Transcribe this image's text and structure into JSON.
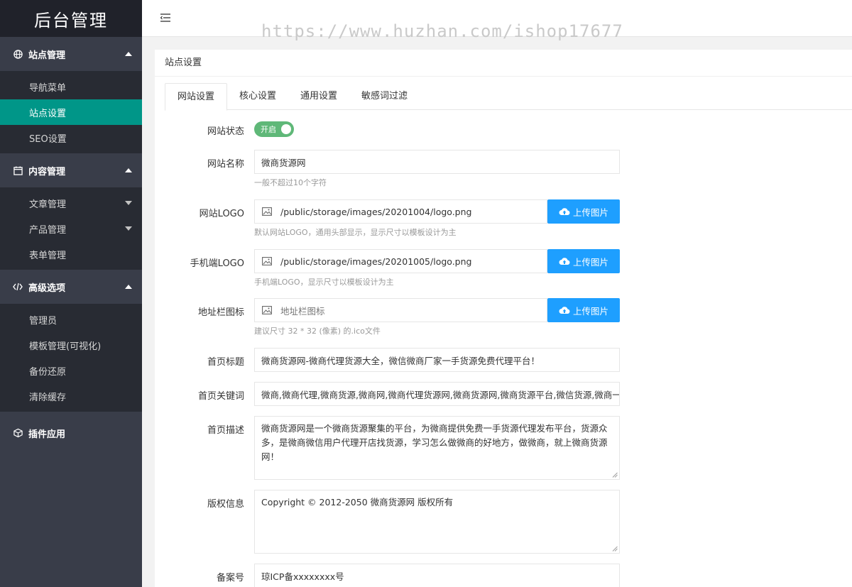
{
  "app": {
    "logo_text": "后台管理"
  },
  "header": {
    "watermark": "https://www.huzhan.com/ishop17677"
  },
  "sidebar": {
    "groups": [
      {
        "label": "站点管理",
        "icon": "globe-icon",
        "items": [
          {
            "label": "导航菜单"
          },
          {
            "label": "站点设置",
            "active": true
          },
          {
            "label": "SEO设置"
          }
        ]
      },
      {
        "label": "内容管理",
        "icon": "calendar-icon",
        "items": [
          {
            "label": "文章管理",
            "has_children": true
          },
          {
            "label": "产品管理",
            "has_children": true
          },
          {
            "label": "表单管理"
          }
        ]
      },
      {
        "label": "高级选项",
        "icon": "code-icon",
        "items": [
          {
            "label": "管理员"
          },
          {
            "label": "模板管理(可视化)"
          },
          {
            "label": "备份还原"
          },
          {
            "label": "清除缓存"
          }
        ]
      },
      {
        "label": "插件应用",
        "icon": "cube-icon",
        "items": []
      }
    ]
  },
  "card": {
    "title": "站点设置"
  },
  "tabs": [
    {
      "label": "网站设置",
      "active": true
    },
    {
      "label": "核心设置"
    },
    {
      "label": "通用设置"
    },
    {
      "label": "敏感词过滤"
    }
  ],
  "form": {
    "status": {
      "label": "网站状态",
      "switch_text": "开启",
      "on": true
    },
    "site_name": {
      "label": "网站名称",
      "value": "微商货源网",
      "hint": "一般不超过10个字符"
    },
    "site_logo": {
      "label": "网站LOGO",
      "value": "/public/storage/images/20201004/logo.png",
      "hint": "默认网站LOGO，通用头部显示，显示尺寸以模板设计为主",
      "button": "上传图片"
    },
    "mobile_logo": {
      "label": "手机端LOGO",
      "value": "/public/storage/images/20201005/logo.png",
      "hint": "手机端LOGO，显示尺寸以模板设计为主",
      "button": "上传图片"
    },
    "favicon": {
      "label": "地址栏图标",
      "placeholder": "地址栏图标",
      "hint": "建议尺寸 32 * 32 (像素) 的.ico文件",
      "button": "上传图片"
    },
    "home_title": {
      "label": "首页标题",
      "value": "微商货源网-微商代理货源大全，微信微商厂家一手货源免费代理平台！"
    },
    "home_keywords": {
      "label": "首页关键词",
      "value": "微商,微商代理,微商货源,微商网,微商代理货源网,微商货源网,微商货源平台,微信货源,微商一"
    },
    "home_desc": {
      "label": "首页描述",
      "value": "微商货源网是一个微商货源聚集的平台，为微商提供免费一手货源代理发布平台，货源众多，是微商微信用户代理开店找货源，学习怎么做微商的好地方，做微商，就上微商货源网！"
    },
    "copyright": {
      "label": "版权信息",
      "value": "Copyright © 2012-2050 微商货源网 版权所有"
    },
    "icp": {
      "label": "备案号",
      "value": "琼ICP备xxxxxxxx号"
    }
  },
  "colors": {
    "sidebar_bg": "#393d49",
    "active": "#009688",
    "upload": "#1e9fff",
    "switch_on": "#5fb878"
  }
}
